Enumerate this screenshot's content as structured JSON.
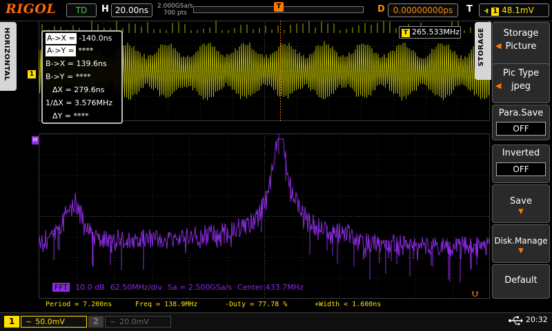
{
  "top_bar": {
    "logo": "RIGOL",
    "run_status": "TD",
    "horizontal_letter": "H",
    "timebase": "20.00ns",
    "sample_rate": "2.000GSa/s",
    "memory_depth": "700  pts",
    "delay_letter": "D",
    "delay": "0.00000000ps",
    "trigger_letter": "T",
    "trigger_source": "1",
    "trigger_level": "48.1mV"
  },
  "left_tab": {
    "label": "HORIZONTAL"
  },
  "markers": {
    "ch1": "1",
    "math": "M",
    "trig_pos": "T"
  },
  "frequency_counter": {
    "icon": "T",
    "value": "265.533MHz"
  },
  "cursor_panel": [
    {
      "label": "A->X =",
      "value": "-140.0ns",
      "selected": true
    },
    {
      "label": "A->Y =",
      "value": "****",
      "selected": true
    },
    {
      "label": "B->X =",
      "value": "139.6ns",
      "selected": false
    },
    {
      "label": "B->Y =",
      "value": "****",
      "selected": false
    },
    {
      "label": "ΔX =",
      "value": "279.6ns",
      "selected": false
    },
    {
      "label": "1/ΔX =",
      "value": "3.576MHz",
      "selected": false
    },
    {
      "label": "ΔY =",
      "value": "****",
      "selected": false
    }
  ],
  "fft_info": {
    "tag": "FFT",
    "scale": "10.0 dB",
    "hdiv": "62.50MHz/div",
    "sa": "Sa = 2.500GSa/s",
    "center": "Center:433.7MHz"
  },
  "measurements": {
    "period": "Period = 7.200ns",
    "freq": "Freq = 138.9MHz",
    "duty": "-Duty = 77.78 %",
    "width": "+Width < 1.600ns"
  },
  "channels": [
    {
      "badge": "1",
      "coupling": "~",
      "scale": "50.0mV",
      "enabled": true
    },
    {
      "badge": "2",
      "coupling": "~",
      "scale": "20.0mV",
      "enabled": false
    }
  ],
  "status": {
    "usb_icon": "usb-icon",
    "clock": "20:32"
  },
  "storage_menu": {
    "tab_label": "STORAGE",
    "storage_title": "Storage",
    "storage_value": "Picture",
    "pictype_title": "Pic Type",
    "pictype_value": "jpeg",
    "parasave_title": "Para.Save",
    "parasave_value": "OFF",
    "inverted_title": "Inverted",
    "inverted_value": "OFF",
    "save_label": "Save",
    "disk_label": "Disk.Manage",
    "default_label": "Default"
  },
  "colors": {
    "ch1": "#ffe100",
    "trace_ch1": "#b0b000",
    "math": "#8b2be2",
    "accent": "#ff7a00",
    "grid": "#2c2c2c"
  }
}
